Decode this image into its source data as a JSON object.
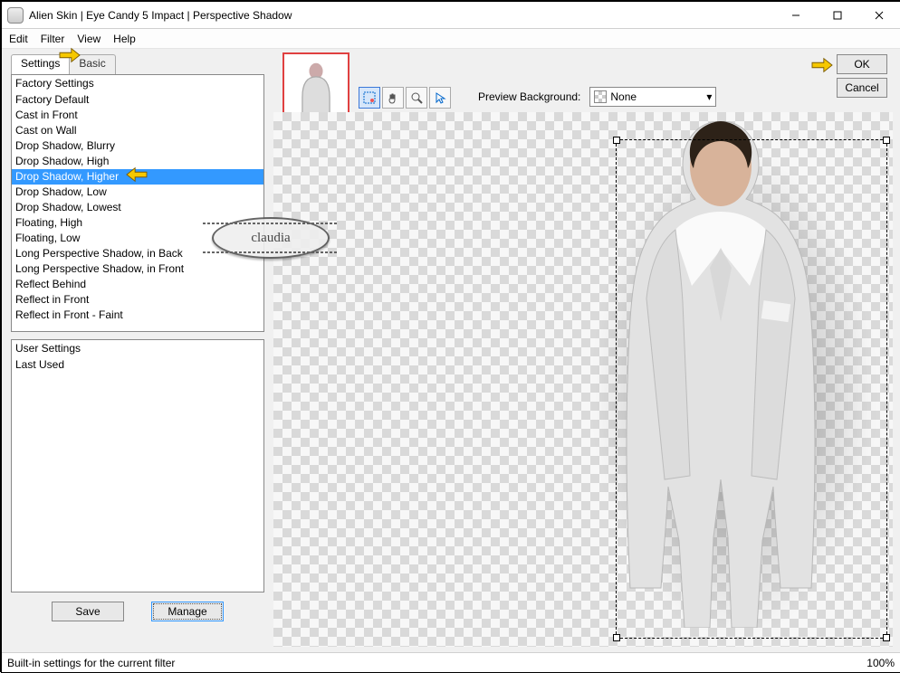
{
  "window": {
    "title": "Alien Skin | Eye Candy 5 Impact | Perspective Shadow"
  },
  "menu": {
    "edit": "Edit",
    "filter": "Filter",
    "view": "View",
    "help": "Help"
  },
  "tabs": {
    "settings": "Settings",
    "basic": "Basic"
  },
  "factory": {
    "header": "Factory Settings",
    "items": [
      "Factory Default",
      "Cast in Front",
      "Cast on Wall",
      "Drop Shadow, Blurry",
      "Drop Shadow, High",
      "Drop Shadow, Higher",
      "Drop Shadow, Low",
      "Drop Shadow, Lowest",
      "Floating, High",
      "Floating, Low",
      "Long Perspective Shadow, in Back",
      "Long Perspective Shadow, in Front",
      "Reflect Behind",
      "Reflect in Front",
      "Reflect in Front - Faint"
    ],
    "selected_index": 5
  },
  "user": {
    "header": "User Settings",
    "items": [
      "Last Used"
    ]
  },
  "buttons": {
    "save": "Save",
    "manage": "Manage",
    "ok": "OK",
    "cancel": "Cancel"
  },
  "preview_bg": {
    "label": "Preview Background:",
    "value": "None"
  },
  "status": {
    "text": "Built-in settings for the current filter",
    "zoom": "100%"
  },
  "watermark": "claudia"
}
